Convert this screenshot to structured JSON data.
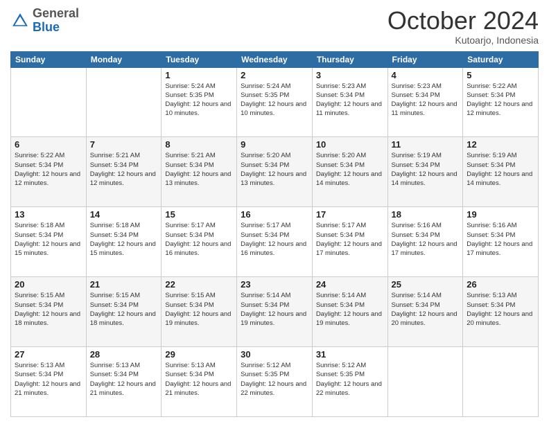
{
  "header": {
    "logo_general": "General",
    "logo_blue": "Blue",
    "month_title": "October 2024",
    "location": "Kutoarjo, Indonesia"
  },
  "days_of_week": [
    "Sunday",
    "Monday",
    "Tuesday",
    "Wednesday",
    "Thursday",
    "Friday",
    "Saturday"
  ],
  "weeks": [
    [
      {
        "day": "",
        "sunrise": "",
        "sunset": "",
        "daylight": ""
      },
      {
        "day": "",
        "sunrise": "",
        "sunset": "",
        "daylight": ""
      },
      {
        "day": "1",
        "sunrise": "Sunrise: 5:24 AM",
        "sunset": "Sunset: 5:35 PM",
        "daylight": "Daylight: 12 hours and 10 minutes."
      },
      {
        "day": "2",
        "sunrise": "Sunrise: 5:24 AM",
        "sunset": "Sunset: 5:35 PM",
        "daylight": "Daylight: 12 hours and 10 minutes."
      },
      {
        "day": "3",
        "sunrise": "Sunrise: 5:23 AM",
        "sunset": "Sunset: 5:34 PM",
        "daylight": "Daylight: 12 hours and 11 minutes."
      },
      {
        "day": "4",
        "sunrise": "Sunrise: 5:23 AM",
        "sunset": "Sunset: 5:34 PM",
        "daylight": "Daylight: 12 hours and 11 minutes."
      },
      {
        "day": "5",
        "sunrise": "Sunrise: 5:22 AM",
        "sunset": "Sunset: 5:34 PM",
        "daylight": "Daylight: 12 hours and 12 minutes."
      }
    ],
    [
      {
        "day": "6",
        "sunrise": "Sunrise: 5:22 AM",
        "sunset": "Sunset: 5:34 PM",
        "daylight": "Daylight: 12 hours and 12 minutes."
      },
      {
        "day": "7",
        "sunrise": "Sunrise: 5:21 AM",
        "sunset": "Sunset: 5:34 PM",
        "daylight": "Daylight: 12 hours and 12 minutes."
      },
      {
        "day": "8",
        "sunrise": "Sunrise: 5:21 AM",
        "sunset": "Sunset: 5:34 PM",
        "daylight": "Daylight: 12 hours and 13 minutes."
      },
      {
        "day": "9",
        "sunrise": "Sunrise: 5:20 AM",
        "sunset": "Sunset: 5:34 PM",
        "daylight": "Daylight: 12 hours and 13 minutes."
      },
      {
        "day": "10",
        "sunrise": "Sunrise: 5:20 AM",
        "sunset": "Sunset: 5:34 PM",
        "daylight": "Daylight: 12 hours and 14 minutes."
      },
      {
        "day": "11",
        "sunrise": "Sunrise: 5:19 AM",
        "sunset": "Sunset: 5:34 PM",
        "daylight": "Daylight: 12 hours and 14 minutes."
      },
      {
        "day": "12",
        "sunrise": "Sunrise: 5:19 AM",
        "sunset": "Sunset: 5:34 PM",
        "daylight": "Daylight: 12 hours and 14 minutes."
      }
    ],
    [
      {
        "day": "13",
        "sunrise": "Sunrise: 5:18 AM",
        "sunset": "Sunset: 5:34 PM",
        "daylight": "Daylight: 12 hours and 15 minutes."
      },
      {
        "day": "14",
        "sunrise": "Sunrise: 5:18 AM",
        "sunset": "Sunset: 5:34 PM",
        "daylight": "Daylight: 12 hours and 15 minutes."
      },
      {
        "day": "15",
        "sunrise": "Sunrise: 5:17 AM",
        "sunset": "Sunset: 5:34 PM",
        "daylight": "Daylight: 12 hours and 16 minutes."
      },
      {
        "day": "16",
        "sunrise": "Sunrise: 5:17 AM",
        "sunset": "Sunset: 5:34 PM",
        "daylight": "Daylight: 12 hours and 16 minutes."
      },
      {
        "day": "17",
        "sunrise": "Sunrise: 5:17 AM",
        "sunset": "Sunset: 5:34 PM",
        "daylight": "Daylight: 12 hours and 17 minutes."
      },
      {
        "day": "18",
        "sunrise": "Sunrise: 5:16 AM",
        "sunset": "Sunset: 5:34 PM",
        "daylight": "Daylight: 12 hours and 17 minutes."
      },
      {
        "day": "19",
        "sunrise": "Sunrise: 5:16 AM",
        "sunset": "Sunset: 5:34 PM",
        "daylight": "Daylight: 12 hours and 17 minutes."
      }
    ],
    [
      {
        "day": "20",
        "sunrise": "Sunrise: 5:15 AM",
        "sunset": "Sunset: 5:34 PM",
        "daylight": "Daylight: 12 hours and 18 minutes."
      },
      {
        "day": "21",
        "sunrise": "Sunrise: 5:15 AM",
        "sunset": "Sunset: 5:34 PM",
        "daylight": "Daylight: 12 hours and 18 minutes."
      },
      {
        "day": "22",
        "sunrise": "Sunrise: 5:15 AM",
        "sunset": "Sunset: 5:34 PM",
        "daylight": "Daylight: 12 hours and 19 minutes."
      },
      {
        "day": "23",
        "sunrise": "Sunrise: 5:14 AM",
        "sunset": "Sunset: 5:34 PM",
        "daylight": "Daylight: 12 hours and 19 minutes."
      },
      {
        "day": "24",
        "sunrise": "Sunrise: 5:14 AM",
        "sunset": "Sunset: 5:34 PM",
        "daylight": "Daylight: 12 hours and 19 minutes."
      },
      {
        "day": "25",
        "sunrise": "Sunrise: 5:14 AM",
        "sunset": "Sunset: 5:34 PM",
        "daylight": "Daylight: 12 hours and 20 minutes."
      },
      {
        "day": "26",
        "sunrise": "Sunrise: 5:13 AM",
        "sunset": "Sunset: 5:34 PM",
        "daylight": "Daylight: 12 hours and 20 minutes."
      }
    ],
    [
      {
        "day": "27",
        "sunrise": "Sunrise: 5:13 AM",
        "sunset": "Sunset: 5:34 PM",
        "daylight": "Daylight: 12 hours and 21 minutes."
      },
      {
        "day": "28",
        "sunrise": "Sunrise: 5:13 AM",
        "sunset": "Sunset: 5:34 PM",
        "daylight": "Daylight: 12 hours and 21 minutes."
      },
      {
        "day": "29",
        "sunrise": "Sunrise: 5:13 AM",
        "sunset": "Sunset: 5:34 PM",
        "daylight": "Daylight: 12 hours and 21 minutes."
      },
      {
        "day": "30",
        "sunrise": "Sunrise: 5:12 AM",
        "sunset": "Sunset: 5:35 PM",
        "daylight": "Daylight: 12 hours and 22 minutes."
      },
      {
        "day": "31",
        "sunrise": "Sunrise: 5:12 AM",
        "sunset": "Sunset: 5:35 PM",
        "daylight": "Daylight: 12 hours and 22 minutes."
      },
      {
        "day": "",
        "sunrise": "",
        "sunset": "",
        "daylight": ""
      },
      {
        "day": "",
        "sunrise": "",
        "sunset": "",
        "daylight": ""
      }
    ]
  ]
}
